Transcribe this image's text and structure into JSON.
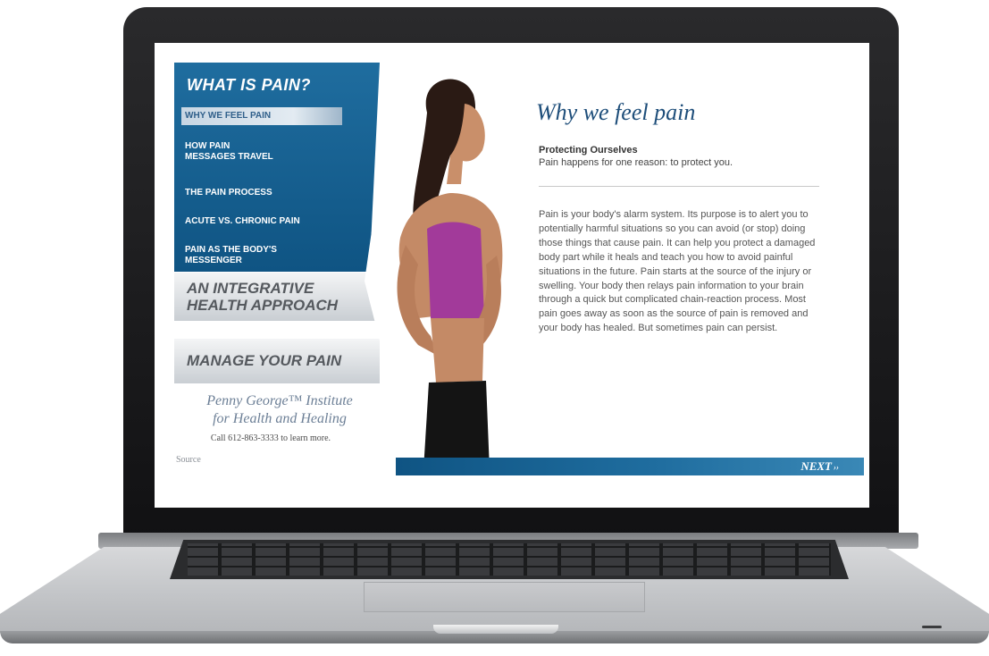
{
  "sidebar": {
    "title": "WHAT IS PAIN?",
    "items": [
      {
        "label": "WHY WE FEEL PAIN"
      },
      {
        "label": "HOW PAIN\nMESSAGES TRAVEL"
      },
      {
        "label": "THE PAIN PROCESS"
      },
      {
        "label": "ACUTE VS. CHRONIC PAIN"
      },
      {
        "label": "PAIN AS THE BODY'S\nMESSENGER"
      }
    ],
    "sections": [
      {
        "label": "AN INTEGRATIVE\nHEALTH APPROACH"
      },
      {
        "label": "MANAGE YOUR PAIN"
      }
    ],
    "institute": {
      "name": "Penny George™ Institute\nfor Health and Healing",
      "call": "Call 612-863-3333 to learn more.",
      "source": "Source"
    }
  },
  "main": {
    "heading": "Why we feel pain",
    "subtitle": "Protecting Ourselves",
    "subtext": "Pain happens for one reason: to protect you.",
    "body": "Pain is your body's alarm system. Its purpose is to alert you to potentially harmful situations so you can avoid (or stop) doing those things that cause pain. It can help you protect a damaged body part while it heals and teach you how to avoid painful situations in the future. Pain starts at the source of the injury or swelling. Your body then relays pain information to your brain through a quick but complicated chain-reaction process. Most pain goes away as soon as the source of pain is removed and your body has healed. But sometimes pain can persist.",
    "next_label": "NEXT",
    "next_icon": "double-chevron-right-icon"
  },
  "colors": {
    "nav_blue": "#0f5483",
    "heading_blue": "#1e4e7a",
    "top_purple": "#a23a9a"
  }
}
